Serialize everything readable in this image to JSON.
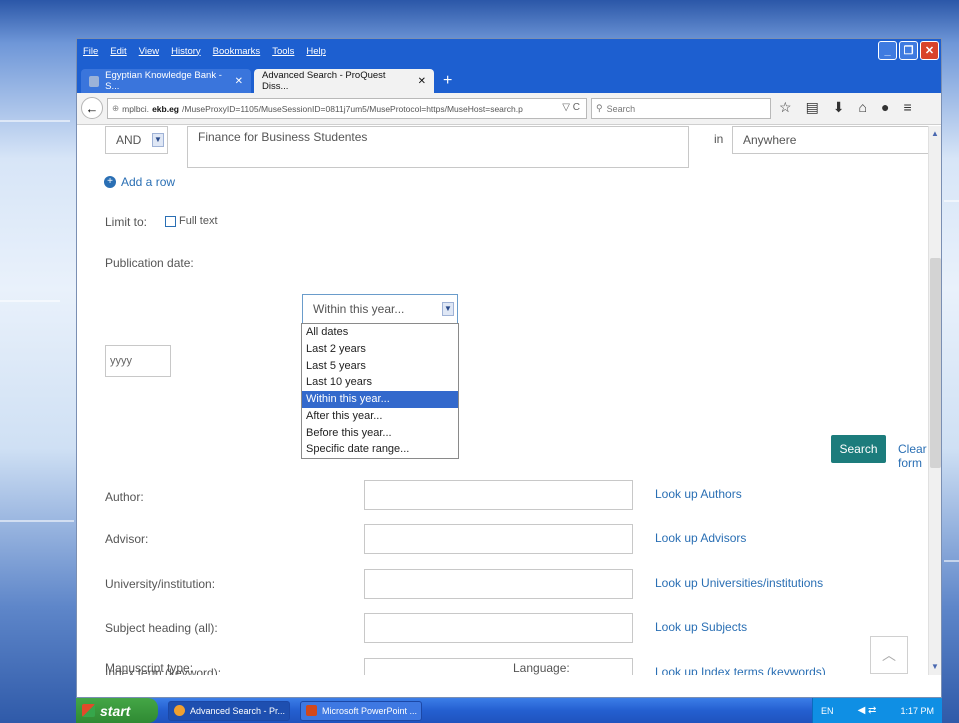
{
  "menubar": {
    "items": [
      "File",
      "Edit",
      "View",
      "History",
      "Bookmarks",
      "Tools",
      "Help"
    ]
  },
  "tabs": [
    {
      "label": "Egyptian Knowledge Bank - S..."
    },
    {
      "label": "Advanced Search - ProQuest Diss..."
    }
  ],
  "nav": {
    "url_prefix": "mplbci.",
    "url_domain": "ekb.eg",
    "url_rest": "/MuseProxyID=1105/MuseSessionID=0811j7um5/MuseProtocol=https/MuseHost=search.p",
    "search_placeholder": "Search"
  },
  "form": {
    "row_operator": "AND",
    "row_text": "Finance for Business Studentes",
    "row_in_label": "in",
    "row_field": "Anywhere",
    "add_row": "Add a row",
    "limit_to_label": "Limit to:",
    "full_text_label": "Full text",
    "pub_date_label": "Publication date:",
    "pub_date_selected": "Within this year...",
    "year_placeholder": "yyyy",
    "date_options": [
      "All dates",
      "Last 2 years",
      "Last 5 years",
      "Last 10 years",
      "Within this year...",
      "After this year...",
      "Before this year...",
      "Specific date range..."
    ],
    "search_button": "Search",
    "clear_form": "Clear form",
    "fields": [
      {
        "label": "Author:",
        "lookup": "Look up Authors"
      },
      {
        "label": "Advisor:",
        "lookup": "Look up Advisors"
      },
      {
        "label": "University/institution:",
        "lookup": "Look up Universities/institutions"
      },
      {
        "label": "Subject heading (all):",
        "lookup": "Look up Subjects"
      },
      {
        "label": "Index term (keyword):",
        "lookup": "Look up Index terms (keywords)"
      }
    ],
    "manuscript_type_label": "Manuscript type:",
    "language_label": "Language:"
  },
  "taskbar": {
    "start": "start",
    "items": [
      {
        "label": "Advanced Search - Pr..."
      },
      {
        "label": "Microsoft PowerPoint ..."
      }
    ],
    "lang": "EN",
    "time": "1:17 PM"
  }
}
